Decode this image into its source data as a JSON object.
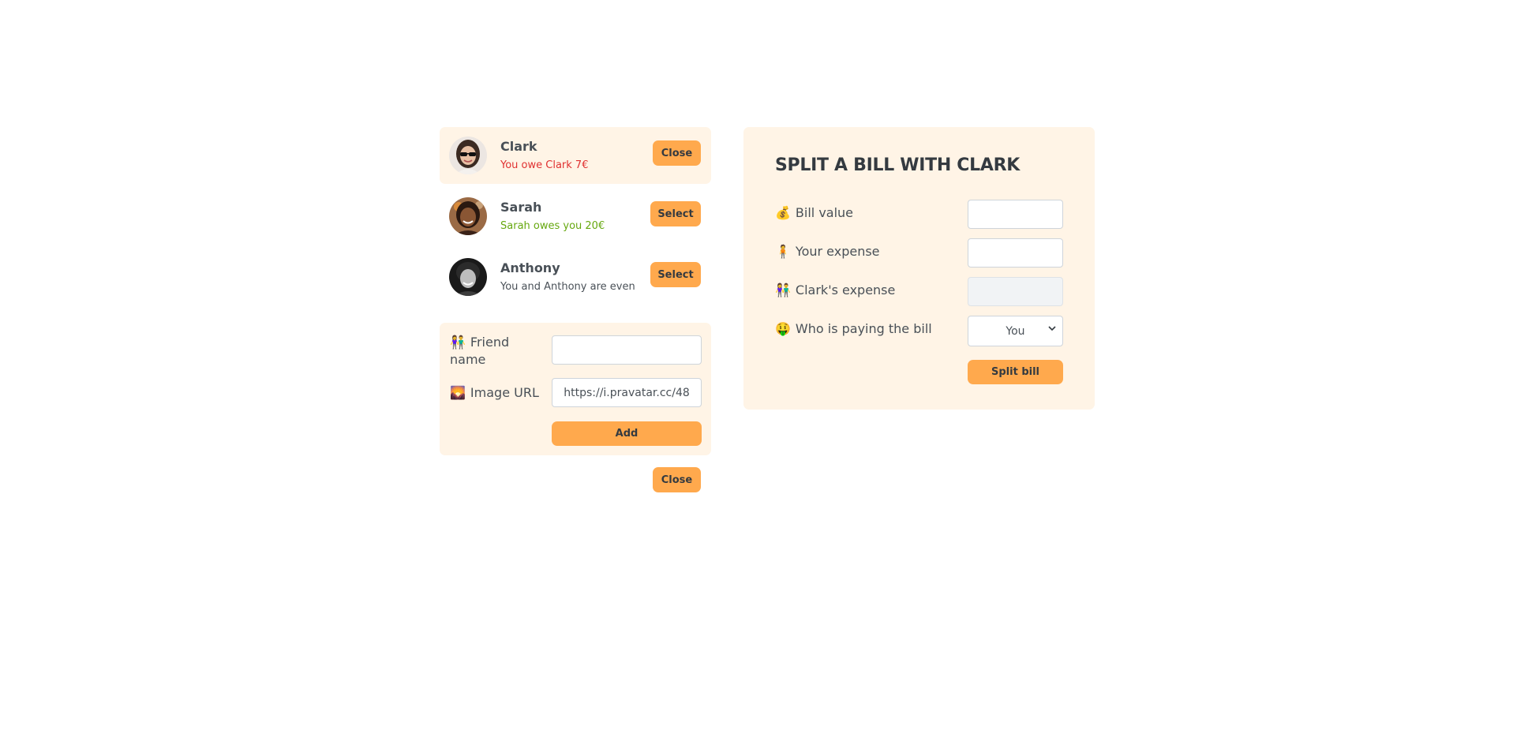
{
  "friends": [
    {
      "name": "Clark",
      "status": "You owe Clark 7€",
      "button": "Close",
      "selected": true
    },
    {
      "name": "Sarah",
      "status": "Sarah owes you 20€",
      "button": "Select",
      "selected": false
    },
    {
      "name": "Anthony",
      "status": "You and Anthony are even",
      "button": "Select",
      "selected": false
    }
  ],
  "add_friend": {
    "name_icon": "👫",
    "name_label_line1": "Friend",
    "name_label_line2": "name",
    "name_value": "",
    "image_icon": "🌄",
    "image_label": "Image URL",
    "image_value": "https://i.pravatar.cc/48",
    "add_label": "Add",
    "close_label": "Close"
  },
  "split": {
    "title": "SPLIT A BILL WITH CLARK",
    "bill_icon": "💰",
    "bill_label": "Bill value",
    "bill_value": "",
    "your_icon": "🧍",
    "your_label": "Your expense",
    "your_value": "",
    "friend_icon": "👫",
    "friend_label": "Clark's expense",
    "friend_value": "",
    "payer_icon": "🤑",
    "payer_label": "Who is paying the bill",
    "payer_selected": "You",
    "split_label": "Split bill"
  },
  "colors": {
    "accent": "#ffa94d",
    "panel": "#fff4e6",
    "owe": "#e03131",
    "owed": "#66a80f"
  }
}
